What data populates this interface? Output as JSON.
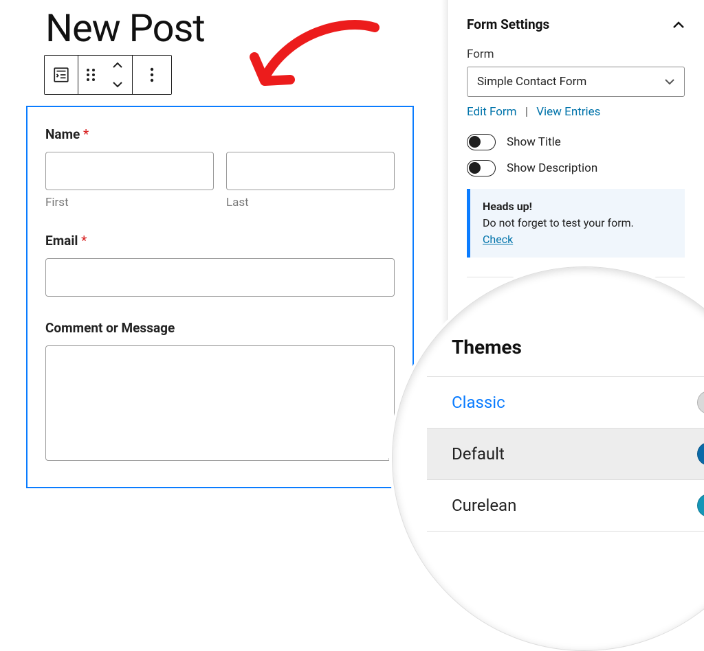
{
  "editor": {
    "title": "New Post",
    "form": {
      "name_label": "Name",
      "first_sublabel": "First",
      "last_sublabel": "Last",
      "email_label": "Email",
      "comment_label": "Comment or Message"
    }
  },
  "sidebar": {
    "panel_title": "Form Settings",
    "form_label": "Form",
    "selected_form": "Simple Contact Form",
    "edit_form": "Edit Form",
    "sep": "|",
    "view_entries": "View Entries",
    "show_title": "Show Title",
    "show_description": "Show Description",
    "notice_heading": "Heads up!",
    "notice_body": "Do not forget to test your form.",
    "notice_link": "Check"
  },
  "themes_panel": {
    "title": "Themes",
    "items": [
      {
        "name": "Classic",
        "active": true,
        "selected": false,
        "colors": [
          "#d9d9d9",
          "#707070",
          "#3c3c3c",
          "#1e1e1e"
        ]
      },
      {
        "name": "Default",
        "active": false,
        "selected": true,
        "colors": [
          "#0b6aa8",
          "#ffffff",
          "#3b3b3b",
          "#1e1e1e"
        ]
      },
      {
        "name": "Curelean",
        "active": false,
        "selected": false,
        "colors": [
          "#1596b7",
          "#eef3f4",
          "#3b3b3b",
          "#1e1e1e"
        ]
      }
    ]
  }
}
